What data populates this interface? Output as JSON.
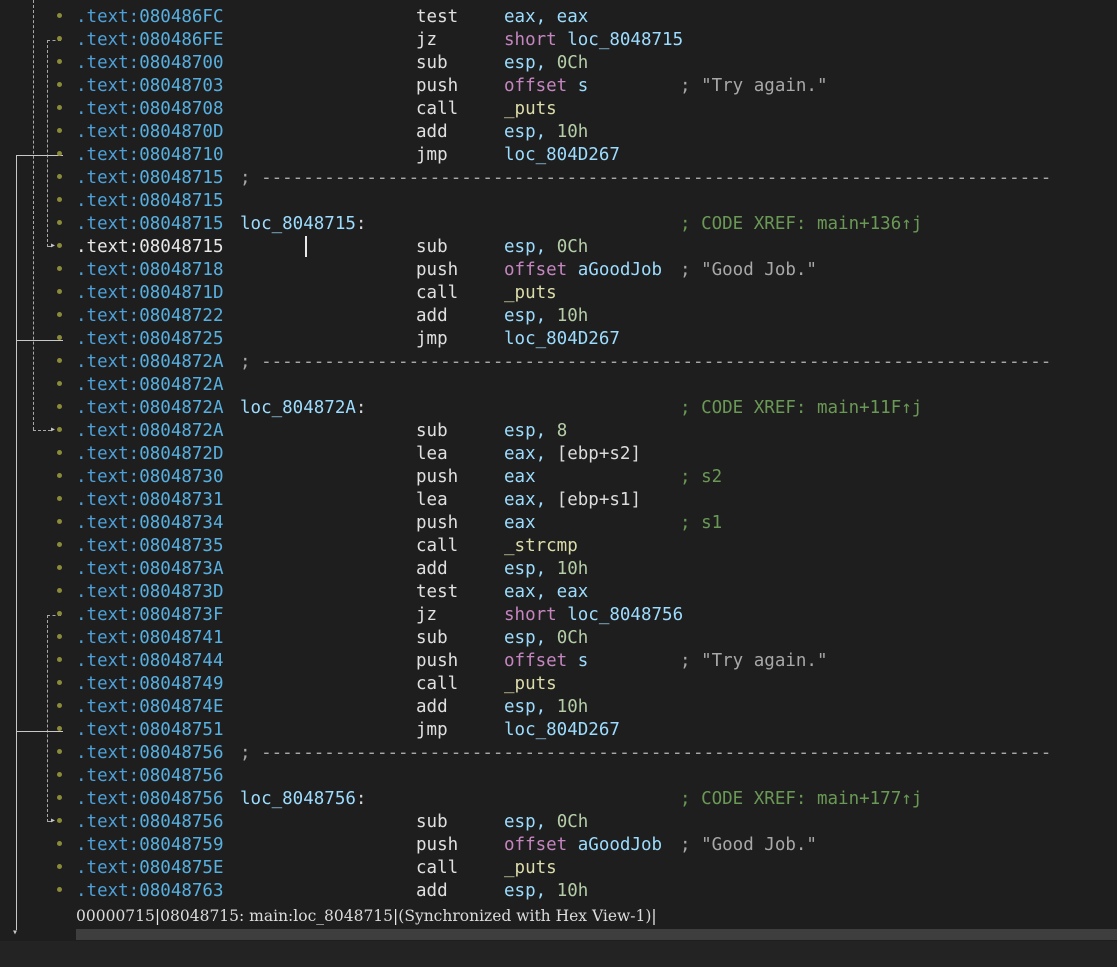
{
  "rows": [
    {
      "seg": ".text:",
      "addr": "080486FC",
      "mnem": "test",
      "ops": [
        {
          "t": "eax, eax",
          "c": "reg"
        }
      ]
    },
    {
      "seg": ".text:",
      "addr": "080486FE",
      "mnem": "jz",
      "ops": [
        {
          "t": "short ",
          "c": "kw"
        },
        {
          "t": "loc_8048715",
          "c": "sym"
        }
      ]
    },
    {
      "seg": ".text:",
      "addr": "08048700",
      "mnem": "sub",
      "ops": [
        {
          "t": "esp, ",
          "c": "reg"
        },
        {
          "t": "0Ch",
          "c": "num"
        }
      ]
    },
    {
      "seg": ".text:",
      "addr": "08048703",
      "mnem": "push",
      "ops": [
        {
          "t": "offset ",
          "c": "kw"
        },
        {
          "t": "s",
          "c": "sym"
        }
      ],
      "comment": "; \"Try again.\"",
      "ctype": "str"
    },
    {
      "seg": ".text:",
      "addr": "08048708",
      "mnem": "call",
      "ops": [
        {
          "t": "_puts",
          "c": "func"
        }
      ]
    },
    {
      "seg": ".text:",
      "addr": "0804870D",
      "mnem": "add",
      "ops": [
        {
          "t": "esp, ",
          "c": "reg"
        },
        {
          "t": "10h",
          "c": "num"
        }
      ]
    },
    {
      "seg": ".text:",
      "addr": "08048710",
      "mnem": "jmp",
      "ops": [
        {
          "t": "loc_804D267",
          "c": "sym"
        }
      ]
    },
    {
      "seg": ".text:",
      "addr": "08048715",
      "sep": "; ---------------------------------------------------------------------------"
    },
    {
      "seg": ".text:",
      "addr": "08048715"
    },
    {
      "seg": ".text:",
      "addr": "08048715",
      "label": "loc_8048715",
      "comment": "; CODE XREF: main+136↑j"
    },
    {
      "seg": ".text:",
      "addr": "08048715",
      "mnem": "sub",
      "ops": [
        {
          "t": "esp, ",
          "c": "reg"
        },
        {
          "t": "0Ch",
          "c": "num"
        }
      ],
      "current": true
    },
    {
      "seg": ".text:",
      "addr": "08048718",
      "mnem": "push",
      "ops": [
        {
          "t": "offset ",
          "c": "kw"
        },
        {
          "t": "aGoodJob",
          "c": "sym"
        }
      ],
      "comment": "; \"Good Job.\"",
      "ctype": "str"
    },
    {
      "seg": ".text:",
      "addr": "0804871D",
      "mnem": "call",
      "ops": [
        {
          "t": "_puts",
          "c": "func"
        }
      ]
    },
    {
      "seg": ".text:",
      "addr": "08048722",
      "mnem": "add",
      "ops": [
        {
          "t": "esp, ",
          "c": "reg"
        },
        {
          "t": "10h",
          "c": "num"
        }
      ]
    },
    {
      "seg": ".text:",
      "addr": "08048725",
      "mnem": "jmp",
      "ops": [
        {
          "t": "loc_804D267",
          "c": "sym"
        }
      ]
    },
    {
      "seg": ".text:",
      "addr": "0804872A",
      "sep": "; ---------------------------------------------------------------------------"
    },
    {
      "seg": ".text:",
      "addr": "0804872A"
    },
    {
      "seg": ".text:",
      "addr": "0804872A",
      "label": "loc_804872A",
      "comment": "; CODE XREF: main+11F↑j"
    },
    {
      "seg": ".text:",
      "addr": "0804872A",
      "mnem": "sub",
      "ops": [
        {
          "t": "esp, ",
          "c": "reg"
        },
        {
          "t": "8",
          "c": "num"
        }
      ]
    },
    {
      "seg": ".text:",
      "addr": "0804872D",
      "mnem": "lea",
      "ops": [
        {
          "t": "eax, ",
          "c": "reg"
        },
        {
          "t": "[ebp+s2]",
          "c": "txt"
        }
      ]
    },
    {
      "seg": ".text:",
      "addr": "08048730",
      "mnem": "push",
      "ops": [
        {
          "t": "eax",
          "c": "reg"
        }
      ],
      "comment": "; s2"
    },
    {
      "seg": ".text:",
      "addr": "08048731",
      "mnem": "lea",
      "ops": [
        {
          "t": "eax, ",
          "c": "reg"
        },
        {
          "t": "[ebp+s1]",
          "c": "txt"
        }
      ]
    },
    {
      "seg": ".text:",
      "addr": "08048734",
      "mnem": "push",
      "ops": [
        {
          "t": "eax",
          "c": "reg"
        }
      ],
      "comment": "; s1"
    },
    {
      "seg": ".text:",
      "addr": "08048735",
      "mnem": "call",
      "ops": [
        {
          "t": "_strcmp",
          "c": "func"
        }
      ]
    },
    {
      "seg": ".text:",
      "addr": "0804873A",
      "mnem": "add",
      "ops": [
        {
          "t": "esp, ",
          "c": "reg"
        },
        {
          "t": "10h",
          "c": "num"
        }
      ]
    },
    {
      "seg": ".text:",
      "addr": "0804873D",
      "mnem": "test",
      "ops": [
        {
          "t": "eax, eax",
          "c": "reg"
        }
      ]
    },
    {
      "seg": ".text:",
      "addr": "0804873F",
      "mnem": "jz",
      "ops": [
        {
          "t": "short ",
          "c": "kw"
        },
        {
          "t": "loc_8048756",
          "c": "sym"
        }
      ]
    },
    {
      "seg": ".text:",
      "addr": "08048741",
      "mnem": "sub",
      "ops": [
        {
          "t": "esp, ",
          "c": "reg"
        },
        {
          "t": "0Ch",
          "c": "num"
        }
      ]
    },
    {
      "seg": ".text:",
      "addr": "08048744",
      "mnem": "push",
      "ops": [
        {
          "t": "offset ",
          "c": "kw"
        },
        {
          "t": "s",
          "c": "sym"
        }
      ],
      "comment": "; \"Try again.\"",
      "ctype": "str"
    },
    {
      "seg": ".text:",
      "addr": "08048749",
      "mnem": "call",
      "ops": [
        {
          "t": "_puts",
          "c": "func"
        }
      ]
    },
    {
      "seg": ".text:",
      "addr": "0804874E",
      "mnem": "add",
      "ops": [
        {
          "t": "esp, ",
          "c": "reg"
        },
        {
          "t": "10h",
          "c": "num"
        }
      ]
    },
    {
      "seg": ".text:",
      "addr": "08048751",
      "mnem": "jmp",
      "ops": [
        {
          "t": "loc_804D267",
          "c": "sym"
        }
      ]
    },
    {
      "seg": ".text:",
      "addr": "08048756",
      "sep": "; ---------------------------------------------------------------------------"
    },
    {
      "seg": ".text:",
      "addr": "08048756"
    },
    {
      "seg": ".text:",
      "addr": "08048756",
      "label": "loc_8048756",
      "comment": "; CODE XREF: main+177↑j"
    },
    {
      "seg": ".text:",
      "addr": "08048756",
      "mnem": "sub",
      "ops": [
        {
          "t": "esp, ",
          "c": "reg"
        },
        {
          "t": "0Ch",
          "c": "num"
        }
      ]
    },
    {
      "seg": ".text:",
      "addr": "08048759",
      "mnem": "push",
      "ops": [
        {
          "t": "offset ",
          "c": "kw"
        },
        {
          "t": "aGoodJob",
          "c": "sym"
        }
      ],
      "comment": "; \"Good Job.\"",
      "ctype": "str"
    },
    {
      "seg": ".text:",
      "addr": "0804875E",
      "mnem": "call",
      "ops": [
        {
          "t": "_puts",
          "c": "func"
        }
      ]
    },
    {
      "seg": ".text:",
      "addr": "08048763",
      "mnem": "add",
      "ops": [
        {
          "t": "esp, ",
          "c": "reg"
        },
        {
          "t": "10h",
          "c": "num"
        }
      ]
    }
  ],
  "status": {
    "offset": "00000715",
    "location": "08048715: main:loc_8048715",
    "sync": "(Synchronized with Hex View-1)"
  },
  "colors": {
    "background": "#1e1e1e",
    "address": "#58b0e0",
    "keyword": "#c586c0",
    "symbol": "#9cdcfe",
    "function": "#dcdcaa",
    "number": "#b5cea8",
    "comment": "#6a9955"
  }
}
